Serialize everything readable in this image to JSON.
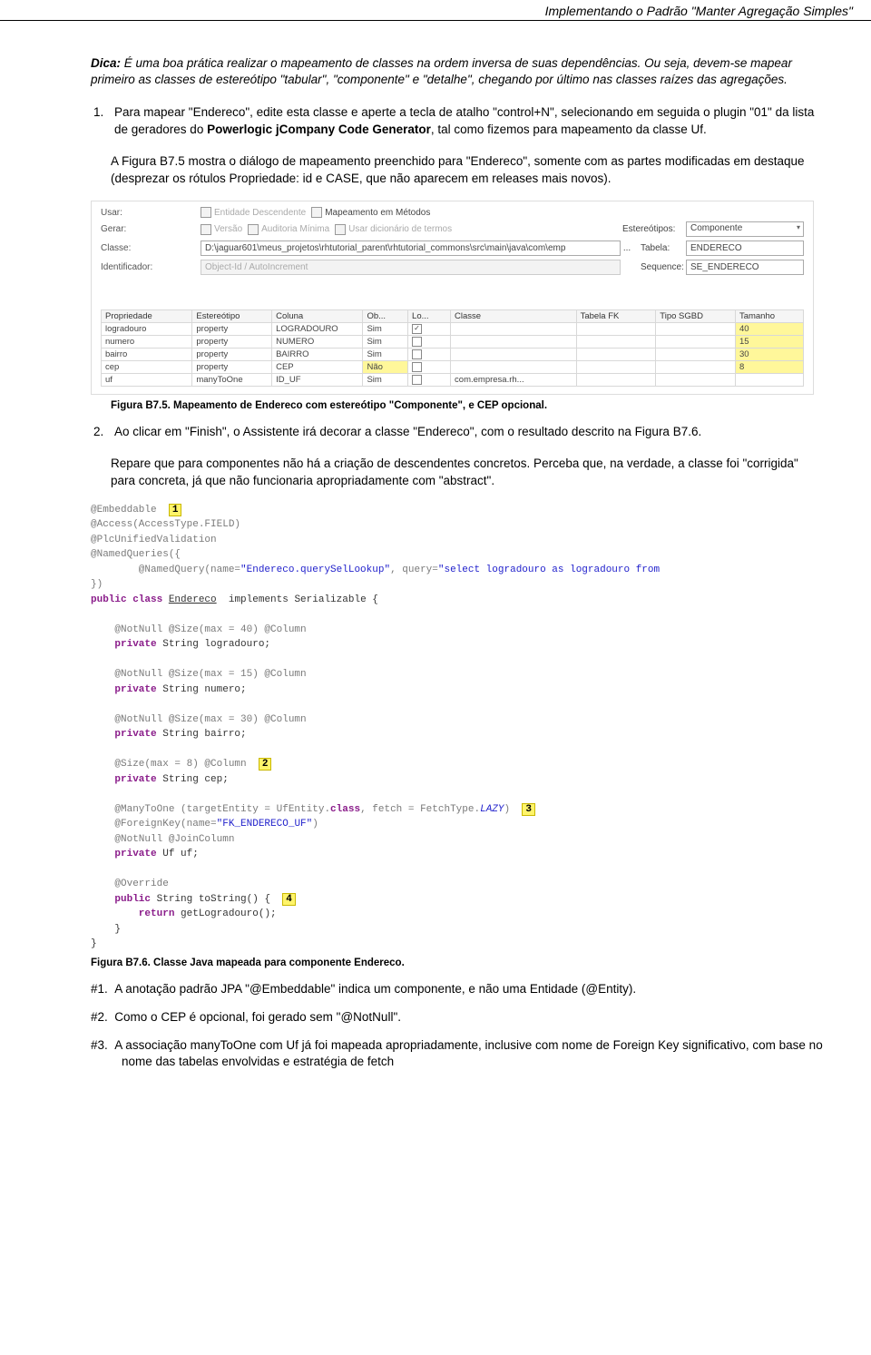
{
  "header": "Implementando o Padrão \"Manter Agregação Simples\"",
  "tip": {
    "label": "Dica:",
    "body": "É uma boa prática realizar o mapeamento de classes na ordem inversa de suas dependências. Ou seja, devem-se mapear primeiro as classes de estereótipo \"tabular\", \"componente\" e \"detalhe\", chegando por último nas classes raízes das agregações."
  },
  "step1": {
    "text_a": "Para mapear \"Endereco\", edite esta classe e aperte a tecla de atalho \"control+N\", selecionando em seguida o plugin \"01\" da lista de geradores do ",
    "text_b": "Powerlogic jCompany Code Generator",
    "text_c": ", tal como fizemos para mapeamento da classe Uf."
  },
  "p1": "A Figura B7.5 mostra o diálogo de mapeamento preenchido para \"Endereco\", somente com as partes modificadas em destaque (desprezar os rótulos Propriedade: id e CASE, que não aparecem em releases mais novos).",
  "shot1": {
    "labels": {
      "usar": "Usar:",
      "gerar": "Gerar:",
      "classe": "Classe:",
      "ident": "Identificador:",
      "estereo": "Estereótipos:",
      "tabela": "Tabela:",
      "sequence": "Sequence:"
    },
    "chk": {
      "ent": "Entidade Descendente",
      "map": "Mapeamento em Métodos",
      "ver": "Versão",
      "aud": "Auditoria Mínima",
      "dic": "Usar dicionário de termos"
    },
    "vals": {
      "classe": "D:\\jaguar601\\meus_projetos\\rhtutorial_parent\\rhtutorial_commons\\src\\main\\java\\com\\emp",
      "ident": "Object-Id / AutoIncrement",
      "estereo": "Componente",
      "tabela": "ENDERECO",
      "sequence": "SE_ENDERECO"
    },
    "thead": [
      "Propriedade",
      "Estereótipo",
      "Coluna",
      "Ob...",
      "Lo...",
      "Classe",
      "Tabela FK",
      "Tipo SGBD",
      "Tamanho"
    ],
    "rows": [
      {
        "p": "logradouro",
        "e": "property",
        "c": "LOGRADOURO",
        "ob": "Sim",
        "chk": true,
        "cl": "",
        "fk": "",
        "sg": "",
        "t": "40",
        "hl": true
      },
      {
        "p": "numero",
        "e": "property",
        "c": "NUMERO",
        "ob": "Sim",
        "chk": false,
        "cl": "",
        "fk": "",
        "sg": "",
        "t": "15",
        "hl": true
      },
      {
        "p": "bairro",
        "e": "property",
        "c": "BAIRRO",
        "ob": "Sim",
        "chk": false,
        "cl": "",
        "fk": "",
        "sg": "",
        "t": "30",
        "hl": true
      },
      {
        "p": "cep",
        "e": "property",
        "c": "CEP",
        "ob": "Não",
        "obhl": true,
        "chk": false,
        "cl": "",
        "fk": "",
        "sg": "",
        "t": "8",
        "hl": true
      },
      {
        "p": "uf",
        "e": "manyToOne",
        "c": "ID_UF",
        "ob": "Sim",
        "chk": false,
        "cl": "com.empresa.rh...",
        "fk": "",
        "sg": "",
        "t": "",
        "hl": false
      }
    ]
  },
  "caption1": "Figura B7.5. Mapeamento de Endereco com estereótipo \"Componente\", e CEP opcional.",
  "step2": {
    "text": "Ao clicar em \"Finish\", o Assistente irá  decorar a classe \"Endereco\", com o resultado descrito na Figura B7.6."
  },
  "p2": "Repare que para componentes não há a criação de descendentes concretos. Perceba que, na verdade, a classe foi \"corrigida\" para concreta, já que não funcionaria apropriadamente com \"abstract\".",
  "code": {
    "l01a": "@Embeddable",
    "tag1": "1",
    "l02": "@Access(AccessType.FIELD)",
    "l03": "@PlcUnifiedValidation",
    "l04": "@NamedQueries({",
    "l05a": "        @NamedQuery(name=",
    "l05s1": "\"Endereco.querySelLookup\"",
    "l05b": ", query=",
    "l05s2": "\"select logradouro as logradouro from ",
    "l06": "})",
    "l07a": "public class ",
    "l07b": "Endereco",
    "l07c": "  implements Serializable {",
    "l09": "    @NotNull @Size(max = 40) @Column",
    "l10a": "    private ",
    "l10b": "String logradouro;",
    "l12": "    @NotNull @Size(max = 15) @Column",
    "l13a": "    private ",
    "l13b": "String numero;",
    "l15": "    @NotNull @Size(max = 30) @Column",
    "l16a": "    private ",
    "l16b": "String bairro;",
    "l18a": "    @Size(max = 8) @Column",
    "tag2": "2",
    "l19a": "    private ",
    "l19b": "String cep;",
    "l21a": "    @ManyToOne (targetEntity = UfEntity.",
    "l21b": "class",
    "l21c": ", fetch = FetchType.",
    "l21d": "LAZY",
    "l21e": ")",
    "tag3": "3",
    "l22a": "    @ForeignKey(name=",
    "l22s": "\"FK_ENDERECO_UF\"",
    "l22b": ")",
    "l23": "    @NotNull @JoinColumn",
    "l24a": "    private ",
    "l24b": "Uf uf;",
    "l26": "    @Override",
    "l27a": "    public ",
    "l27b": "String toString() {",
    "tag4": "4",
    "l28a": "        return ",
    "l28b": "getLogradouro();",
    "l29": "    }",
    "l30": "}"
  },
  "caption2": "Figura B7.6. Classe Java mapeada para componente Endereco.",
  "hash": {
    "n1": "#1.",
    "t1": "A anotação padrão JPA \"@Embeddable\" indica um componente, e não uma Entidade (@Entity).",
    "n2": "#2.",
    "t2": "Como o CEP é opcional, foi gerado sem \"@NotNull\".",
    "n3": "#3.",
    "t3": "A associação manyToOne com Uf já foi mapeada apropriadamente, inclusive com nome de Foreign Key significativo, com base no nome das tabelas envolvidas e estratégia de fetch"
  }
}
